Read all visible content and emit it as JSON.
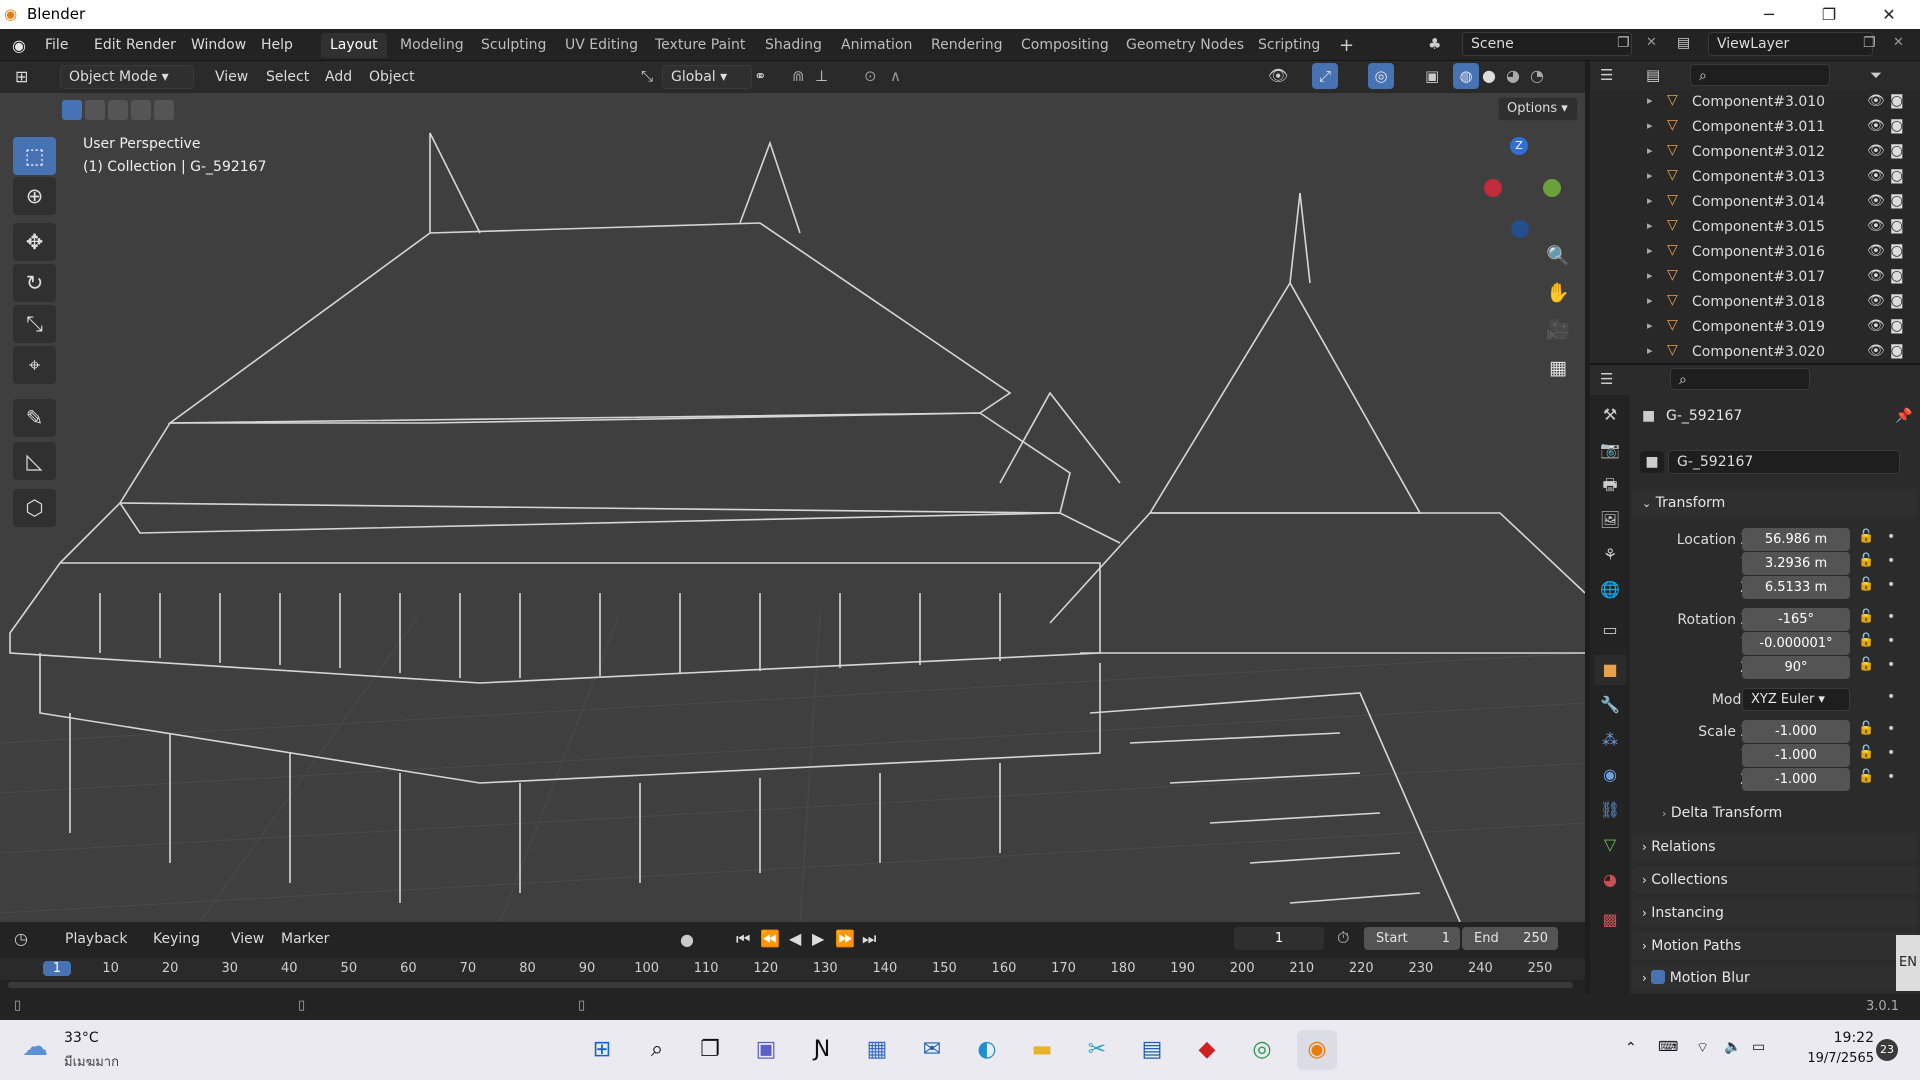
{
  "window": {
    "title": "Blender",
    "minimize": "─",
    "maximize": "❐",
    "close": "✕"
  },
  "menu": [
    "File",
    "Edit",
    "Render",
    "Window",
    "Help"
  ],
  "workspaces": [
    "Layout",
    "Modeling",
    "Sculpting",
    "UV Editing",
    "Texture Paint",
    "Shading",
    "Animation",
    "Rendering",
    "Compositing",
    "Geometry Nodes",
    "Scripting"
  ],
  "add_workspace": "+",
  "scene": "Scene",
  "view_layer": "ViewLayer",
  "viewport_header": {
    "mode": "Object Mode",
    "menus": [
      "View",
      "Select",
      "Add",
      "Object"
    ],
    "orientation": "Global",
    "options": "Options"
  },
  "viewport": {
    "perspective": "User Perspective",
    "collection": "(1) Collection | G-_592167",
    "gizmo": {
      "z": "Z"
    }
  },
  "outliner": {
    "items": [
      "Component#3.010",
      "Component#3.011",
      "Component#3.012",
      "Component#3.013",
      "Component#3.014",
      "Component#3.015",
      "Component#3.016",
      "Component#3.017",
      "Component#3.018",
      "Component#3.019",
      "Component#3.020"
    ]
  },
  "properties": {
    "object_name": "G-_592167",
    "datablock_name": "G-_592167",
    "transform": {
      "title": "Transform",
      "location_label": "Location X",
      "location": [
        "56.986 m",
        "3.2936 m",
        "6.5133 m"
      ],
      "rotation_label": "Rotation X",
      "rotation": [
        "-165°",
        "-0.000001°",
        "90°"
      ],
      "mode_label": "Mode",
      "mode": "XYZ Euler",
      "scale_label": "Scale X",
      "scale": [
        "-1.000",
        "-1.000",
        "-1.000"
      ],
      "y": "Y",
      "z": "Z"
    },
    "delta": "Delta Transform",
    "panels": [
      "Relations",
      "Collections",
      "Instancing",
      "Motion Paths",
      "Motion Blur"
    ]
  },
  "timeline": {
    "menus": [
      "Playback",
      "Keying",
      "View",
      "Marker"
    ],
    "current_frame": "1",
    "start_label": "Start",
    "start": "1",
    "end_label": "End",
    "end": "250",
    "ticks": [
      "1",
      "10",
      "20",
      "30",
      "40",
      "50",
      "60",
      "70",
      "80",
      "90",
      "100",
      "110",
      "120",
      "130",
      "140",
      "150",
      "160",
      "170",
      "180",
      "190",
      "200",
      "210",
      "220",
      "230",
      "240",
      "250"
    ]
  },
  "status": {
    "version": "3.0.1",
    "lang": "EN"
  },
  "taskbar": {
    "temp": "33°C",
    "weather": "มีเมฆมาก",
    "time": "19:22",
    "date": "19/7/2565",
    "notifications": "23"
  },
  "colors": {
    "accent": "#4772b3",
    "brand": "#e87d0d"
  }
}
